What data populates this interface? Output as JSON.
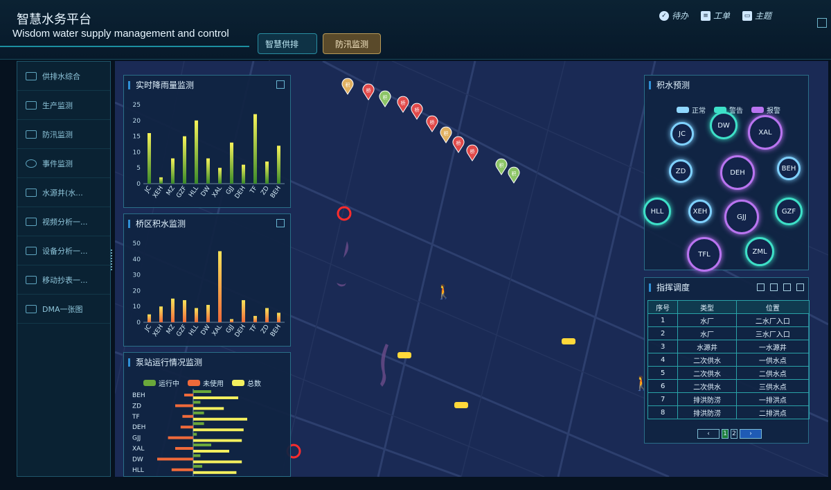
{
  "header": {
    "title_cn": "智慧水务平台",
    "title_en": "Wisdom water supply management and control",
    "tabs": [
      {
        "label": "智慧供排水..."
      },
      {
        "label": "防汛监测"
      }
    ],
    "toolbar": [
      {
        "label": "待办",
        "icon": "todo-icon"
      },
      {
        "label": "工单",
        "icon": "work-order-icon"
      },
      {
        "label": "主题",
        "icon": "theme-icon"
      }
    ]
  },
  "sidebar": {
    "items": [
      {
        "label": "供排水综合",
        "icon": "monitor-icon"
      },
      {
        "label": "生产监测",
        "icon": "factory-icon"
      },
      {
        "label": "防汛监测",
        "icon": "pulse-icon"
      },
      {
        "label": "事件监测",
        "icon": "bell-icon"
      },
      {
        "label": "水源井(水...",
        "icon": "camera-icon"
      },
      {
        "label": "视频分析一...",
        "icon": "camera-icon"
      },
      {
        "label": "设备分析一...",
        "icon": "camera-icon"
      },
      {
        "label": "移动抄表一...",
        "icon": "camera-icon"
      },
      {
        "label": "DMA一张图",
        "icon": "camera-icon"
      }
    ]
  },
  "rain_panel": {
    "title": "实时降雨量监测"
  },
  "bridge_panel": {
    "title": "桥区积水监测"
  },
  "pump_panel": {
    "title": "泵站运行情况监测",
    "legend": [
      "运行中",
      "未使用",
      "总数"
    ],
    "colors": [
      "#6aa83a",
      "#f06a3a",
      "#f3ef5e"
    ]
  },
  "water_panel": {
    "title": "积水预测",
    "legend": [
      "正常",
      "警告",
      "报警"
    ],
    "legend_colors": [
      "#8fd7ff",
      "#3ee0c8",
      "#b974f0"
    ],
    "bubbles": [
      {
        "label": "JC",
        "status": "normal"
      },
      {
        "label": "DW",
        "status": "warning"
      },
      {
        "label": "XAL",
        "status": "alarm"
      },
      {
        "label": "ZD",
        "status": "normal"
      },
      {
        "label": "DEH",
        "status": "alarm"
      },
      {
        "label": "BEH",
        "status": "normal"
      },
      {
        "label": "HLL",
        "status": "warning"
      },
      {
        "label": "XEH",
        "status": "normal"
      },
      {
        "label": "GJJ",
        "status": "alarm"
      },
      {
        "label": "GZF",
        "status": "warning"
      },
      {
        "label": "TFL",
        "status": "alarm"
      },
      {
        "label": "ZML",
        "status": "warning"
      }
    ]
  },
  "dispatch_panel": {
    "title": "指挥调度",
    "headers": [
      "序号",
      "类型",
      "位置"
    ],
    "rows": [
      [
        "1",
        "水厂",
        "二水厂入口"
      ],
      [
        "2",
        "水厂",
        "三水厂入口"
      ],
      [
        "3",
        "水源井",
        "一水源井"
      ],
      [
        "4",
        "二次供水",
        "一供水点"
      ],
      [
        "5",
        "二次供水",
        "二供水点"
      ],
      [
        "6",
        "二次供水",
        "三供水点"
      ],
      [
        "7",
        "排洪防涝",
        "一排洪点"
      ],
      [
        "8",
        "排洪防涝",
        "二排洪点"
      ]
    ],
    "pager": {
      "pages": [
        "1",
        "2"
      ],
      "current": "1"
    }
  },
  "map": {
    "marker_labels": [
      "积",
      "桥",
      "积",
      "桥",
      "桥",
      "桥",
      "积",
      "桥",
      "桥",
      "积",
      "积"
    ]
  },
  "chart_data": [
    {
      "type": "bar",
      "title": "实时降雨量监测",
      "categories": [
        "JC",
        "XEH",
        "MZ",
        "GZF",
        "HLL",
        "DW",
        "XAL",
        "GJJ",
        "DEH",
        "TF",
        "ZD",
        "BEH"
      ],
      "values": [
        16,
        2,
        8,
        15,
        20,
        8,
        5,
        13,
        6,
        22,
        7,
        12
      ],
      "ylim": [
        0,
        25
      ],
      "yticks": [
        0,
        5,
        10,
        15,
        20,
        25
      ]
    },
    {
      "type": "bar",
      "title": "桥区积水监测",
      "categories": [
        "JC",
        "XEH",
        "MZ",
        "GZF",
        "HLL",
        "DW",
        "XAL",
        "GJJ",
        "DEH",
        "TF",
        "ZD",
        "BEH"
      ],
      "values": [
        5,
        10,
        15,
        14,
        9,
        11,
        45,
        2,
        14,
        4,
        9,
        6
      ],
      "ylim": [
        0,
        50
      ],
      "yticks": [
        0,
        10,
        20,
        30,
        40,
        50
      ]
    },
    {
      "type": "bar",
      "title": "泵站运行情况监测",
      "categories": [
        "BEH",
        "ZD",
        "TF",
        "DEH",
        "GJJ",
        "XAL",
        "DW",
        "HLL"
      ],
      "series": [
        {
          "name": "运行中",
          "values": [
            10,
            4,
            6,
            6,
            2,
            10,
            4,
            5
          ]
        },
        {
          "name": "未使用",
          "values": [
            -5,
            -10,
            -6,
            -7,
            -14,
            -10,
            -20,
            -12
          ]
        },
        {
          "name": "总数",
          "values": [
            25,
            17,
            30,
            28,
            27,
            20,
            27,
            24
          ]
        }
      ]
    }
  ]
}
